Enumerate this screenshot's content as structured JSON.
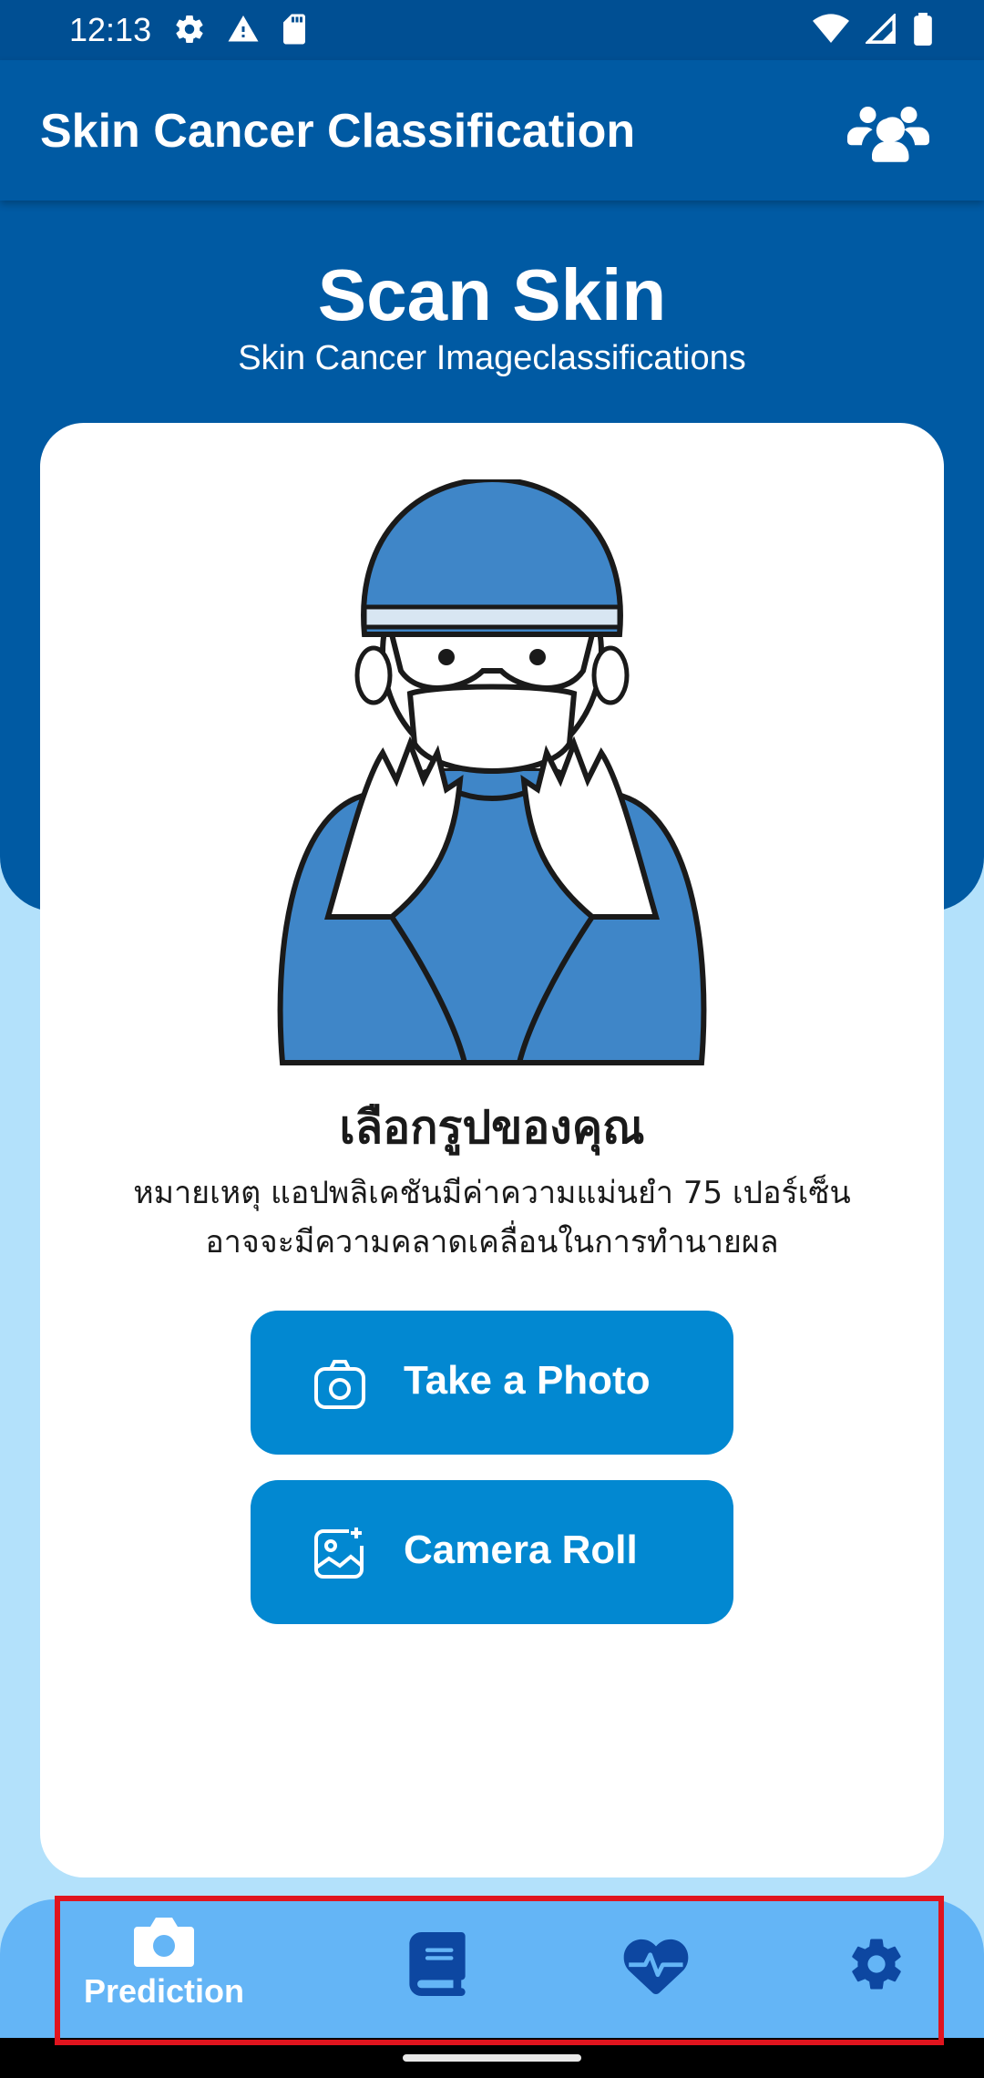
{
  "status_bar": {
    "time": "12:13",
    "left_icons": [
      "gear-icon",
      "warning-icon",
      "sd-card-icon"
    ],
    "right_icons": [
      "wifi-icon",
      "signal-icon",
      "battery-icon"
    ]
  },
  "app_bar": {
    "title": "Skin Cancer Classification",
    "users_icon": "users-icon"
  },
  "hero": {
    "title": "Scan Skin",
    "subtitle": "Skin Cancer Imageclassifications"
  },
  "card": {
    "illustration": "doctor-illustration",
    "choose_title": "เลือกรูปของคุณ",
    "note_line1": "หมายเหตุ แอปพลิเคชันมีค่าความแม่นยำ 75 เปอร์เซ็น",
    "note_line2": "อาจจะมีความคลาดเคลื่อนในการทำนายผล",
    "buttons": [
      {
        "label": "Take a Photo",
        "icon": "camera-icon"
      },
      {
        "label": "Camera Roll",
        "icon": "gallery-add-icon"
      }
    ]
  },
  "bottom_nav": {
    "items": [
      {
        "label": "Prediction",
        "icon": "camera-icon",
        "active": true
      },
      {
        "label": "",
        "icon": "book-icon",
        "active": false
      },
      {
        "label": "",
        "icon": "heartbeat-icon",
        "active": false
      },
      {
        "label": "",
        "icon": "gear-icon",
        "active": false
      }
    ]
  },
  "colors": {
    "primary": "#005aa3",
    "button": "#0288d1",
    "nav": "#64b5f6",
    "background": "#b3e1fb",
    "nav_icon": "#0d47a1"
  }
}
